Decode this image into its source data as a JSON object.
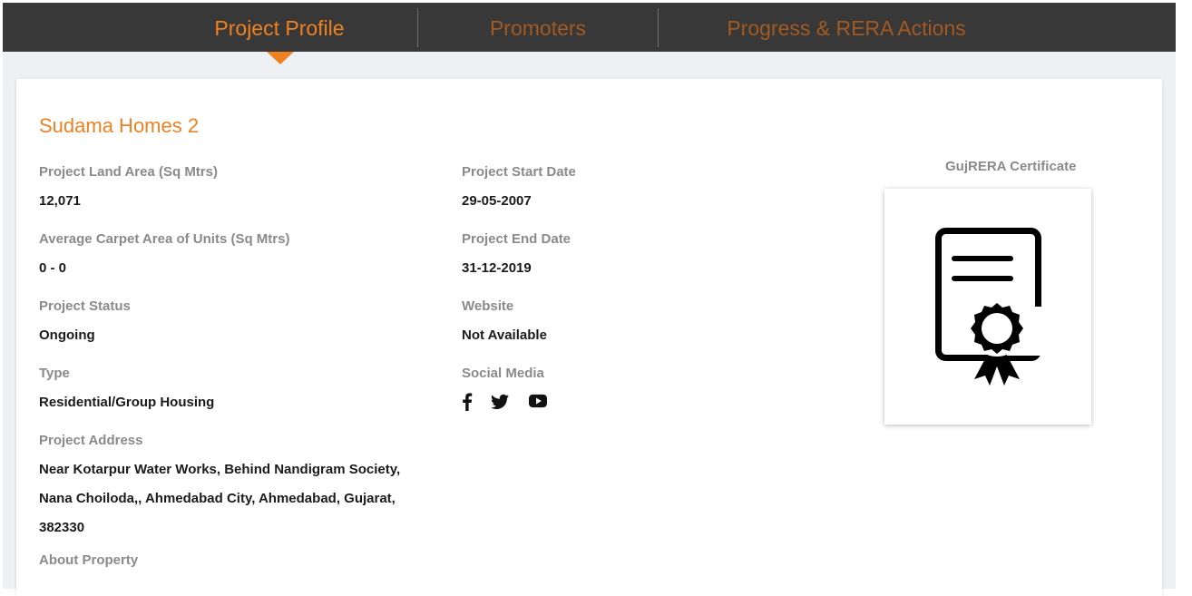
{
  "tabs": [
    {
      "label": "Project Profile",
      "active": true
    },
    {
      "label": "Promoters",
      "active": false
    },
    {
      "label": "Progress & RERA Actions",
      "active": false
    }
  ],
  "project": {
    "name": "Sudama Homes 2",
    "land_area_label": "Project Land Area (Sq Mtrs)",
    "land_area_value": "12,071",
    "carpet_area_label": "Average Carpet Area of Units (Sq Mtrs)",
    "carpet_area_value": "0 - 0",
    "status_label": "Project Status",
    "status_value": "Ongoing",
    "type_label": "Type",
    "type_value": "Residential/Group Housing",
    "address_label": "Project Address",
    "address_lines": [
      "Near Kotarpur Water Works, Behind Nandigram Society,",
      "Nana Choiloda,, Ahmedabad City, Ahmedabad, Gujarat,",
      "382330"
    ],
    "about_label": "About Property",
    "start_date_label": "Project Start Date",
    "start_date_value": "29-05-2007",
    "end_date_label": "Project End Date",
    "end_date_value": "31-12-2019",
    "website_label": "Website",
    "website_value": "Not Available",
    "social_label": "Social Media",
    "social_icons": [
      "facebook-icon",
      "twitter-icon",
      "youtube-icon"
    ]
  },
  "certificate": {
    "label": "GujRERA Certificate",
    "icon": "certificate-icon"
  },
  "colors": {
    "accent": "#ee8122",
    "tab_inactive": "#a35a22",
    "tabbar_bg": "#383838",
    "page_bg": "#eef1f3",
    "label_text": "#8a8a8a",
    "value_text": "#1b1b1b"
  }
}
